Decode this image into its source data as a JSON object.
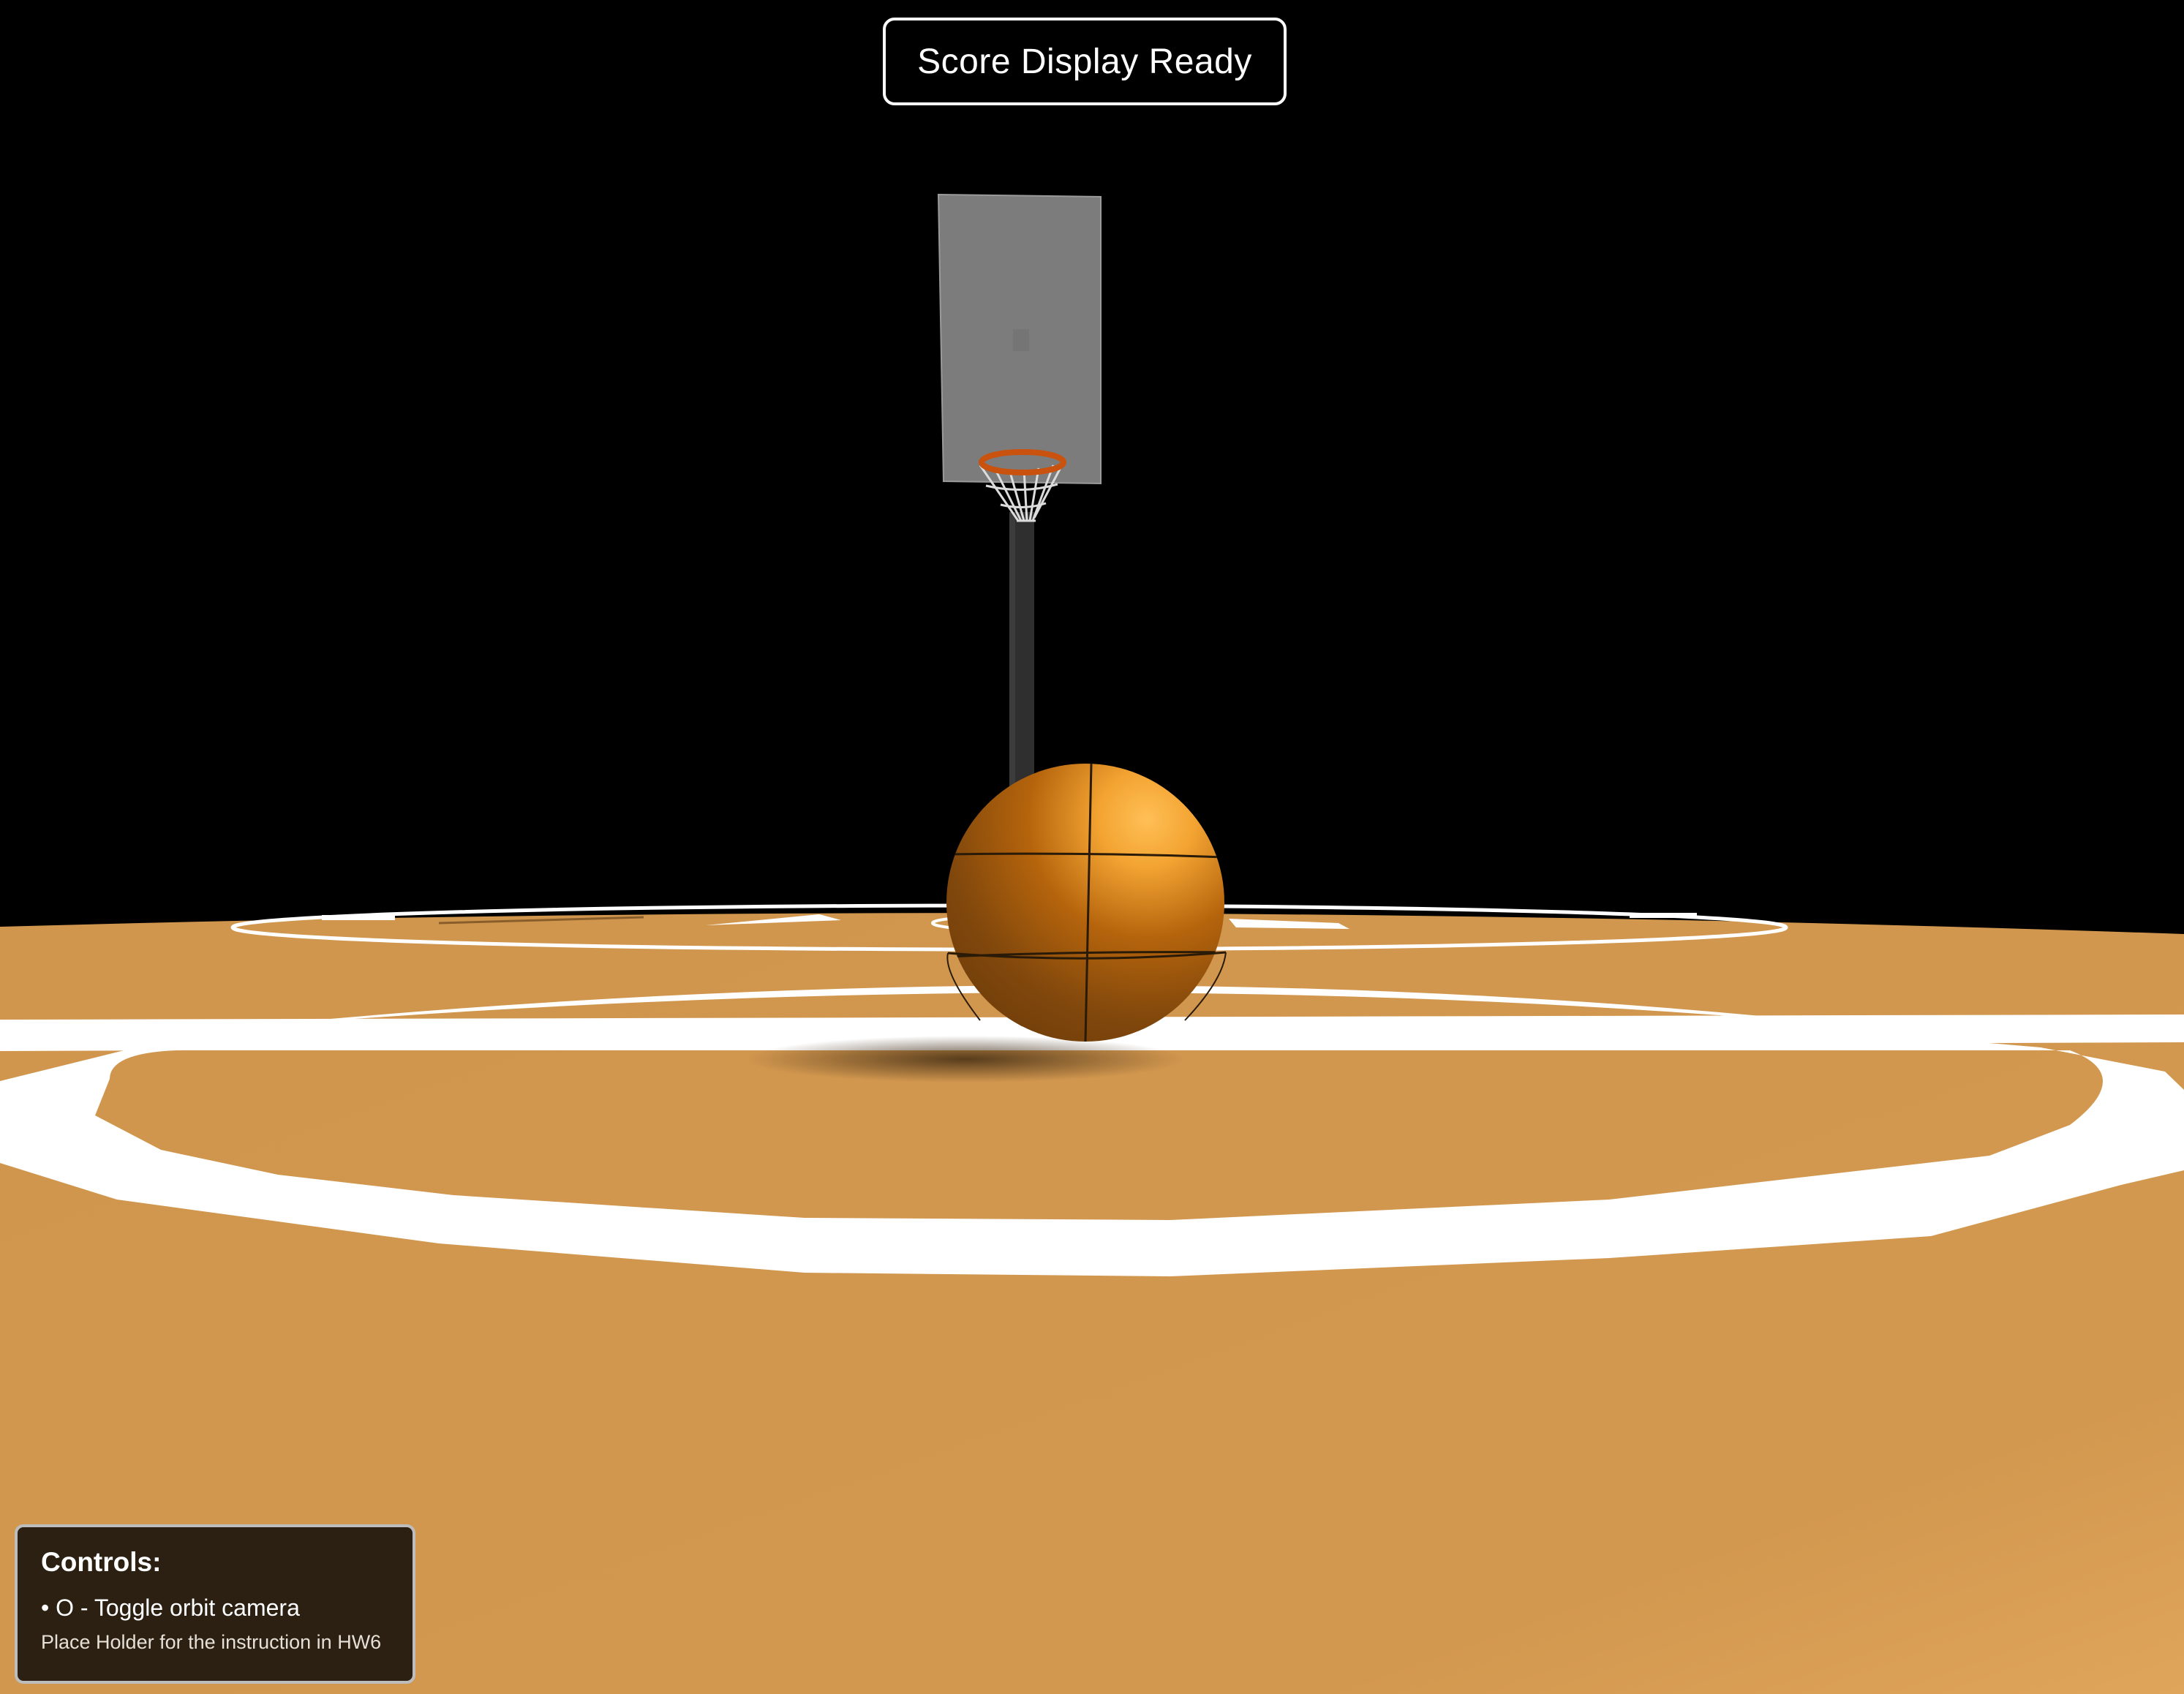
{
  "scene": {
    "background_color": "#000000",
    "court_color": "#d2974f",
    "line_color": "#ffffff",
    "ball_color": "#e08a1e",
    "backboard_color": "#7d7d7d",
    "rim_color": "#d85a10",
    "pole_color": "#2e2e2e",
    "objects": [
      "basketball-court",
      "basketball",
      "backboard",
      "hoop-rim",
      "hoop-net",
      "support-pole"
    ]
  },
  "score_display": {
    "text": "Score Display Ready"
  },
  "controls": {
    "title": "Controls:",
    "items": [
      {
        "text": "• O - Toggle orbit camera"
      }
    ],
    "note": "Place Holder for the instruction in HW6"
  }
}
